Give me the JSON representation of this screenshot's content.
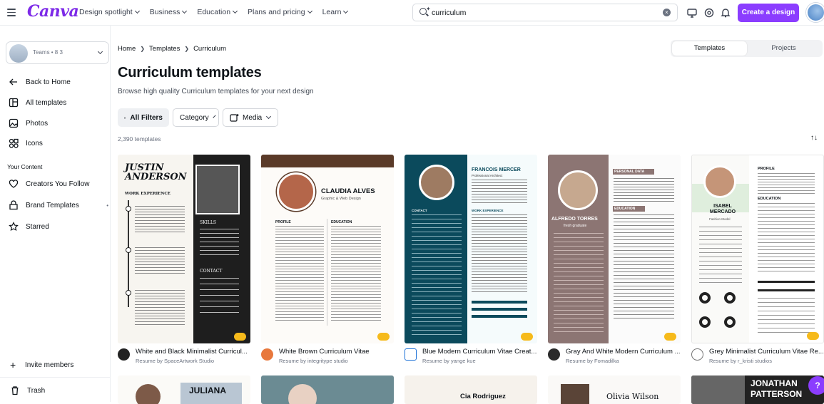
{
  "header": {
    "logo": "Canva",
    "nav": [
      "Design spotlight",
      "Business",
      "Education",
      "Plans and pricing",
      "Learn"
    ],
    "search_value": "curriculum",
    "create_button": "Create a design"
  },
  "sidebar": {
    "team_label": "Teams • 8 3",
    "items": [
      {
        "label": "Back to Home",
        "icon": "arrow-left-icon"
      },
      {
        "label": "All templates",
        "icon": "templates-icon"
      },
      {
        "label": "Photos",
        "icon": "photos-icon"
      },
      {
        "label": "Icons",
        "icon": "shapes-icon"
      }
    ],
    "section_label": "Your Content",
    "content_items": [
      {
        "label": "Creators You Follow",
        "icon": "creators-icon"
      },
      {
        "label": "Brand Templates",
        "icon": "brand-icon"
      },
      {
        "label": "Starred",
        "icon": "star-icon"
      }
    ],
    "invite": "Invite members",
    "trash": "Trash"
  },
  "main": {
    "breadcrumb": [
      "Home",
      "Templates",
      "Curriculum"
    ],
    "tabs": [
      "Templates",
      "Projects"
    ],
    "title": "Curriculum templates",
    "subtitle": "Browse high quality Curriculum templates for your next design",
    "filters": {
      "all": "All Filters",
      "category": "Category",
      "media": "Media"
    },
    "count": "2,390 templates",
    "cards": [
      {
        "title": "White and Black Minimalist Curricul...",
        "by": "Resume by SpaceArtwork Studio",
        "preview_name": "JUSTIN ANDERSON",
        "preview_head": "WORK EXPERIENCE",
        "preview_right": "SKILLS",
        "preview_right2": "CONTACT"
      },
      {
        "title": "White Brown Curriculum Vitae",
        "by": "Resume by integritype studio",
        "preview_name": "CLAUDIA ALVES",
        "preview_sub": "Graphic & Web Design",
        "preview_head": "PROFILE",
        "preview_right": "EDUCATION"
      },
      {
        "title": "Blue Modern Curriculum Vitae Creat...",
        "by": "Resume by yange kue",
        "preview_name": "FRANCOIS MERCER",
        "preview_sub": "Professional Architect",
        "preview_head": "CONTACT",
        "preview_right": "WORK EXPERIENCE"
      },
      {
        "title": "Gray And White Modern Curriculum ...",
        "by": "Resume by Fomadilka",
        "preview_name": "ALFREDO TORRES",
        "preview_sub": "fresh graduate",
        "preview_head": "PERSONAL DATA",
        "preview_right": "EDUCATION"
      },
      {
        "title": "Grey Minimalist Curriculum Vitae Re...",
        "by": "Resume by r_kristi studios",
        "preview_name": "ISABEL MERCADO",
        "preview_sub": "Fashion Model",
        "preview_head": "PROFILE",
        "preview_right": "EDUCATION"
      }
    ],
    "row2_names": [
      "JULIANA",
      "",
      "Cia Rodriguez",
      "Olivia Wilson",
      "JONATHAN PATTERSON"
    ]
  },
  "colors": {
    "accent": "#8b3dff",
    "logo": "#7d2ae8"
  }
}
